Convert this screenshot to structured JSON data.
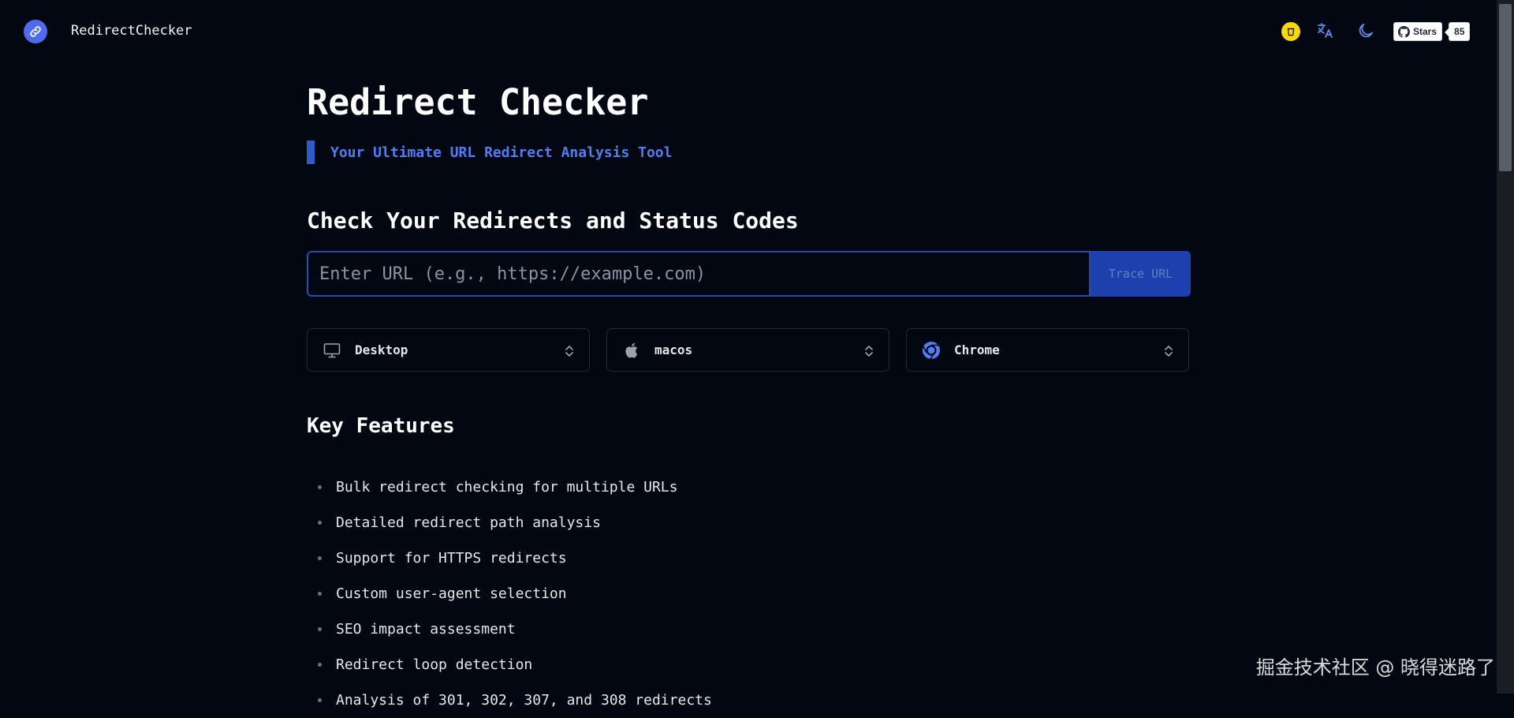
{
  "header": {
    "brand": "RedirectChecker",
    "logo_icon": "link-icon",
    "coffee_icon": "coffee-icon",
    "translate_icon": "translate-icon",
    "theme_icon": "moon-icon",
    "github": {
      "label": "Stars",
      "count": "85"
    }
  },
  "hero": {
    "title": "Redirect Checker",
    "subtitle": "Your Ultimate URL Redirect Analysis Tool"
  },
  "checker": {
    "heading": "Check Your Redirects and Status Codes",
    "input_placeholder": "Enter URL (e.g., https://example.com)",
    "input_value": "",
    "button_label": "Trace URL",
    "selects": [
      {
        "value": "Desktop",
        "icon": "monitor-icon"
      },
      {
        "value": "macos",
        "icon": "apple-icon"
      },
      {
        "value": "Chrome",
        "icon": "chrome-icon"
      }
    ]
  },
  "features": {
    "heading": "Key Features",
    "items": [
      "Bulk redirect checking for multiple URLs",
      "Detailed redirect path analysis",
      "Support for HTTPS redirects",
      "Custom user-agent selection",
      "SEO impact assessment",
      "Redirect loop detection",
      "Analysis of 301, 302, 307, and 308 redirects"
    ]
  },
  "watermark": "掘金技术社区 @ 晓得迷路了",
  "colors": {
    "background": "#030712",
    "accent": "#4f7ef5",
    "button": "#1e40af"
  }
}
